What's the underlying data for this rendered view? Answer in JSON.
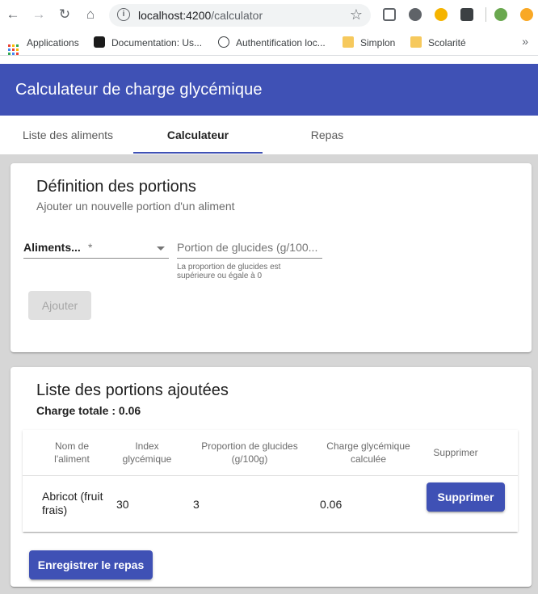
{
  "browser": {
    "url_host": "localhost:4200",
    "url_path": "/calculator",
    "bookmarks": [
      {
        "label": "Applications"
      },
      {
        "label": "Documentation: Us..."
      },
      {
        "label": "Authentification loc..."
      },
      {
        "label": "Simplon"
      },
      {
        "label": "Scolarité"
      }
    ]
  },
  "app": {
    "title": "Calculateur de charge glycémique",
    "accent_color": "#3f51b5"
  },
  "tabs": [
    {
      "label": "Liste des aliments",
      "active": false
    },
    {
      "label": "Calculateur",
      "active": true
    },
    {
      "label": "Repas",
      "active": false
    }
  ],
  "definition": {
    "title": "Définition des portions",
    "subtitle": "Ajouter un nouvelle portion d'un aliment",
    "select_label": "Aliments...",
    "select_required": "*",
    "input_placeholder": "Portion de glucides (g/100...",
    "input_hint": "La proportion de glucides est supérieure ou égale à 0",
    "add_button": "Ajouter"
  },
  "portions": {
    "title": "Liste des portions ajoutées",
    "total": "Charge totale : 0.06",
    "headers": {
      "name": "Nom de l'aliment",
      "index": "Index glycémique",
      "proportion": "Proportion de glucides (g/100g)",
      "charge": "Charge glycémique calculée",
      "delete": "Supprimer"
    },
    "rows": [
      {
        "name": "Abricot (fruit frais)",
        "index": "30",
        "proportion": "3",
        "charge": "0.06",
        "delete_label": "Supprimer"
      }
    ],
    "save_button": "Enregistrer le repas"
  }
}
